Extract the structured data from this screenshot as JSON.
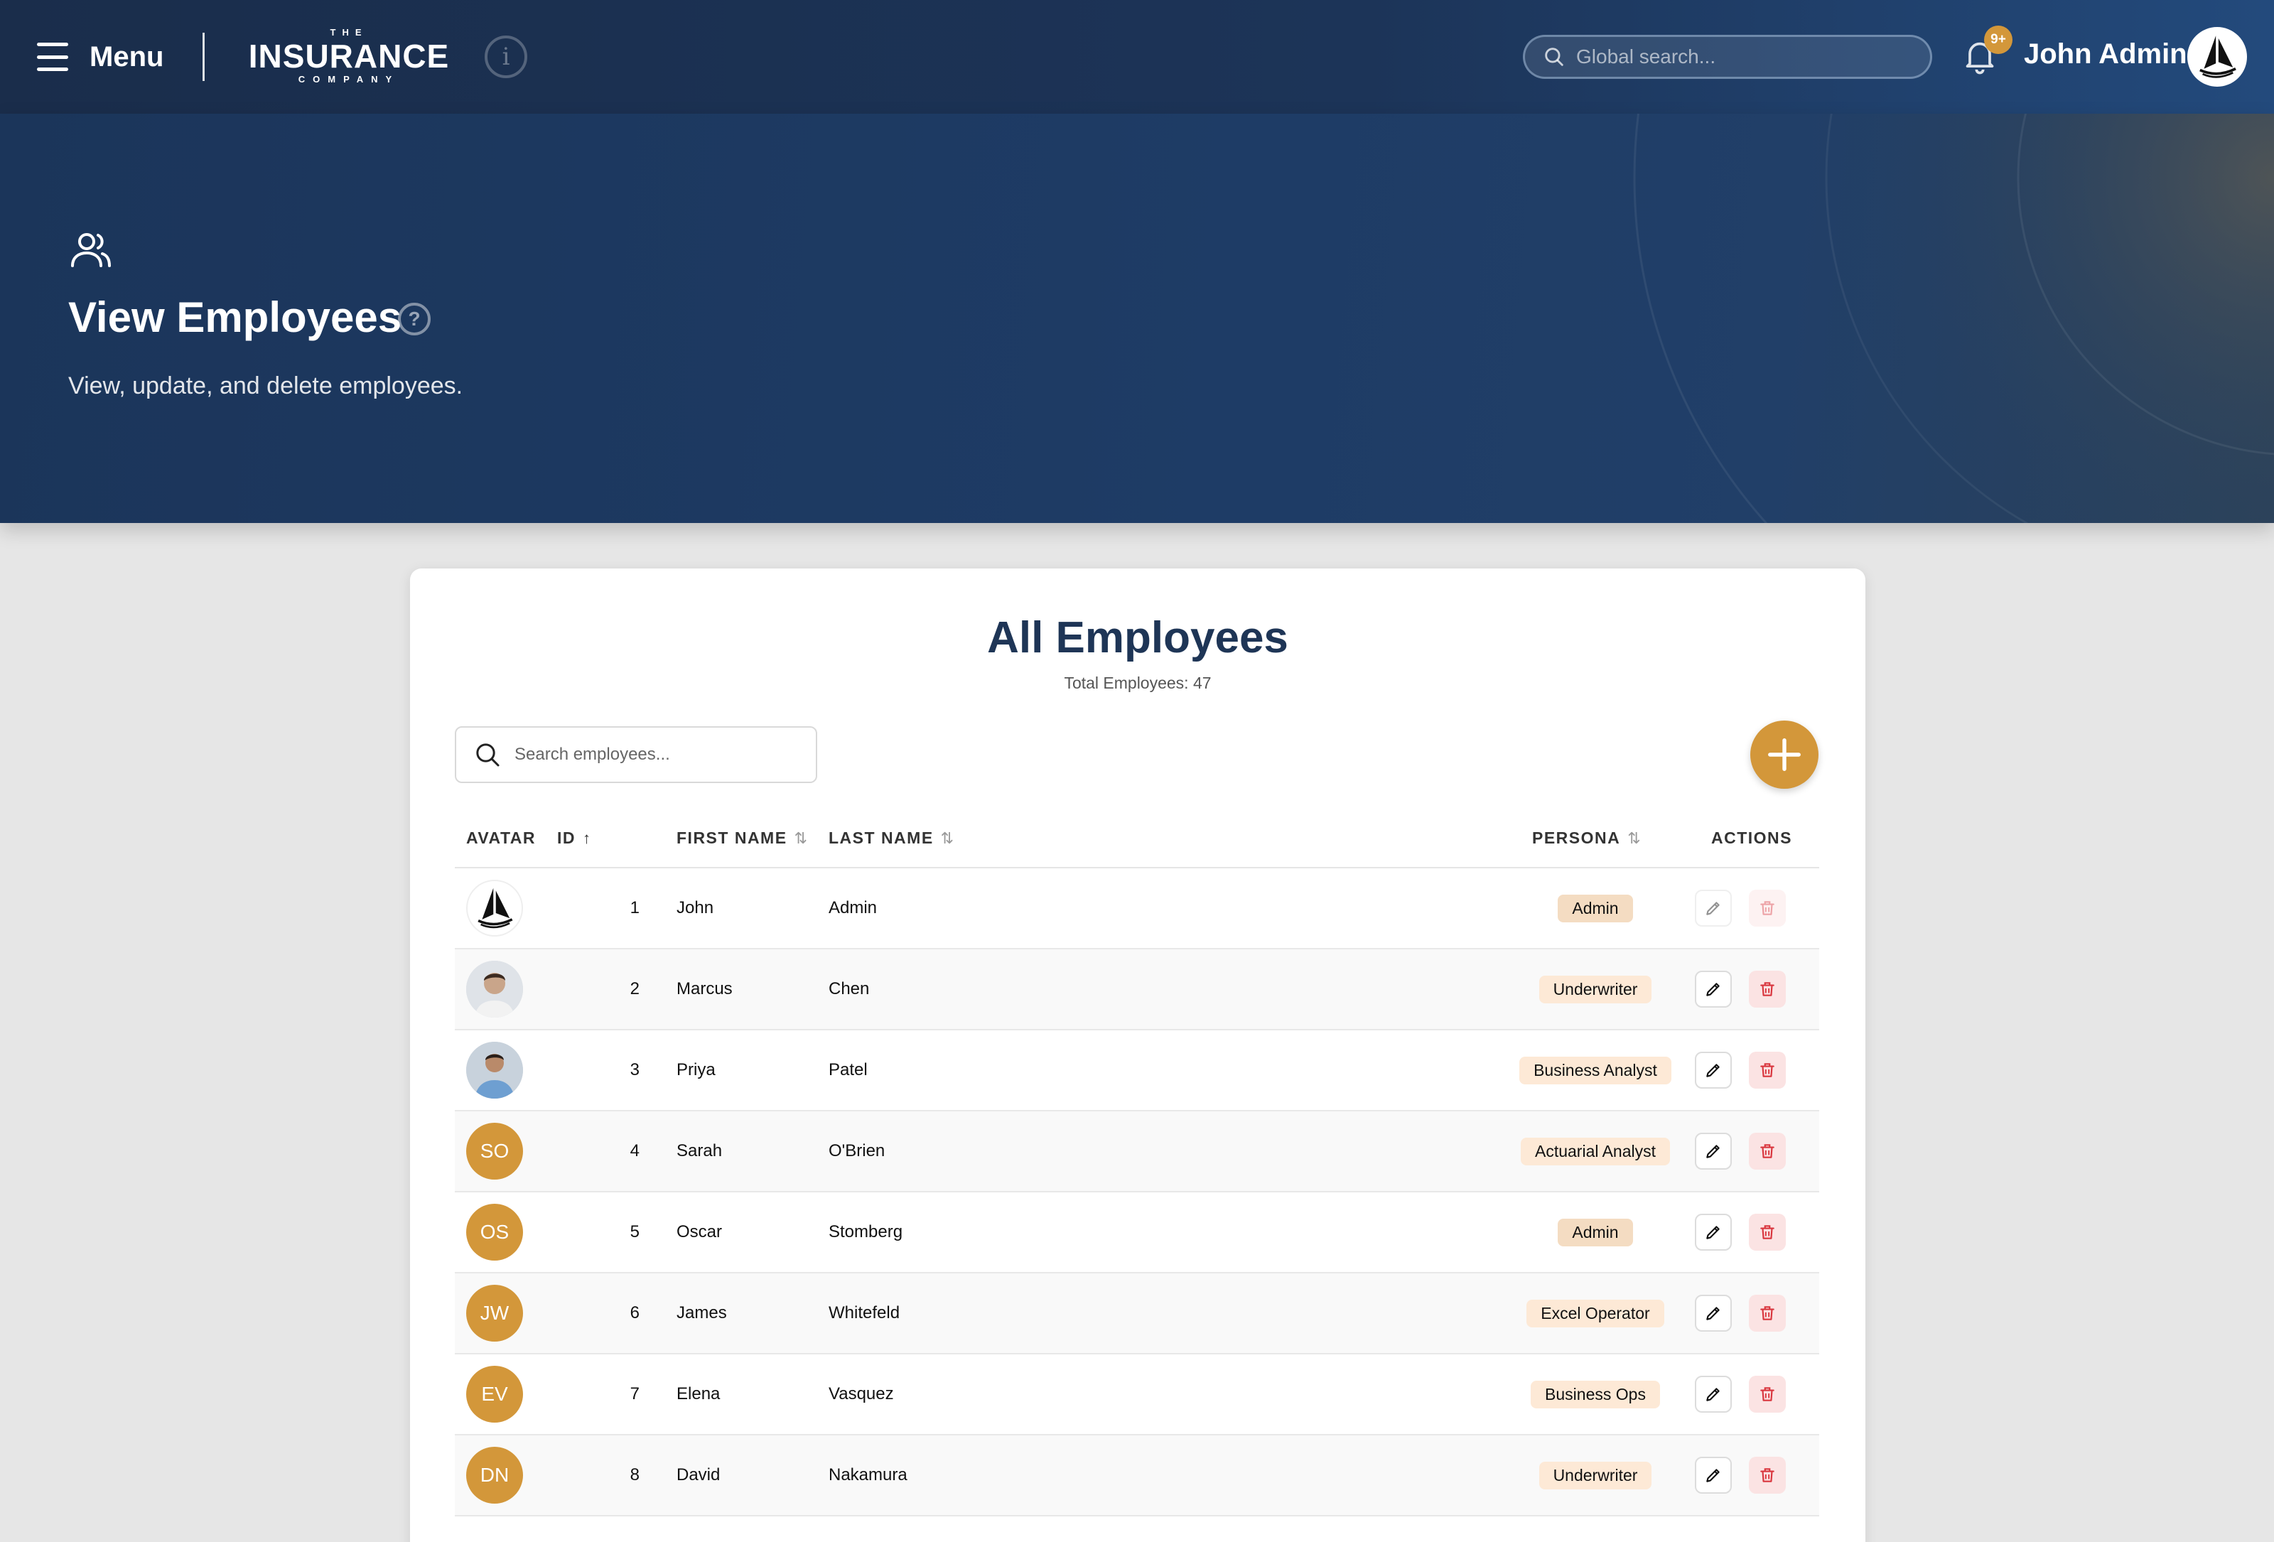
{
  "header": {
    "menu_label": "Menu",
    "logo": {
      "the": "THE",
      "main": "INSURANCE",
      "company": "COMPANY"
    },
    "global_search_placeholder": "Global search...",
    "notification_badge": "9+",
    "user_name": "John Admin"
  },
  "hero": {
    "title": "View Employees",
    "subtitle": "View, update, and delete employees."
  },
  "card": {
    "title": "All Employees",
    "total": "Total Employees: 47",
    "search_placeholder": "Search employees..."
  },
  "table": {
    "columns": {
      "avatar": "AVATAR",
      "id": "ID",
      "first_name": "FIRST NAME",
      "last_name": "LAST NAME",
      "persona": "PERSONA",
      "actions": "ACTIONS"
    },
    "sort_asc_glyph": "↑",
    "sort_both_glyph": "⇅",
    "rows": [
      {
        "id": "1",
        "first": "John",
        "last": "Admin",
        "persona": "Admin",
        "avatar_type": "logo",
        "initials": ""
      },
      {
        "id": "2",
        "first": "Marcus",
        "last": "Chen",
        "persona": "Underwriter",
        "avatar_type": "photo",
        "initials": ""
      },
      {
        "id": "3",
        "first": "Priya",
        "last": "Patel",
        "persona": "Business Analyst",
        "avatar_type": "photo",
        "initials": ""
      },
      {
        "id": "4",
        "first": "Sarah",
        "last": "O'Brien",
        "persona": "Actuarial Analyst",
        "avatar_type": "initials",
        "initials": "SO"
      },
      {
        "id": "5",
        "first": "Oscar",
        "last": "Stomberg",
        "persona": "Admin",
        "avatar_type": "initials",
        "initials": "OS"
      },
      {
        "id": "6",
        "first": "James",
        "last": "Whitefeld",
        "persona": "Excel Operator",
        "avatar_type": "initials",
        "initials": "JW"
      },
      {
        "id": "7",
        "first": "Elena",
        "last": "Vasquez",
        "persona": "Business Ops",
        "avatar_type": "initials",
        "initials": "EV"
      },
      {
        "id": "8",
        "first": "David",
        "last": "Nakamura",
        "persona": "Underwriter",
        "avatar_type": "initials",
        "initials": "DN"
      }
    ]
  },
  "colors": {
    "accent": "#d3973a",
    "header_dark": "#1a2d4b",
    "title_navy": "#1e3556",
    "badge_bg": "#fde9d6",
    "delete_red": "#d9363e"
  },
  "icons": [
    "menu-icon",
    "info-icon",
    "search-icon",
    "bell-icon",
    "users-icon",
    "help-icon",
    "plus-icon",
    "edit-icon",
    "trash-icon"
  ]
}
